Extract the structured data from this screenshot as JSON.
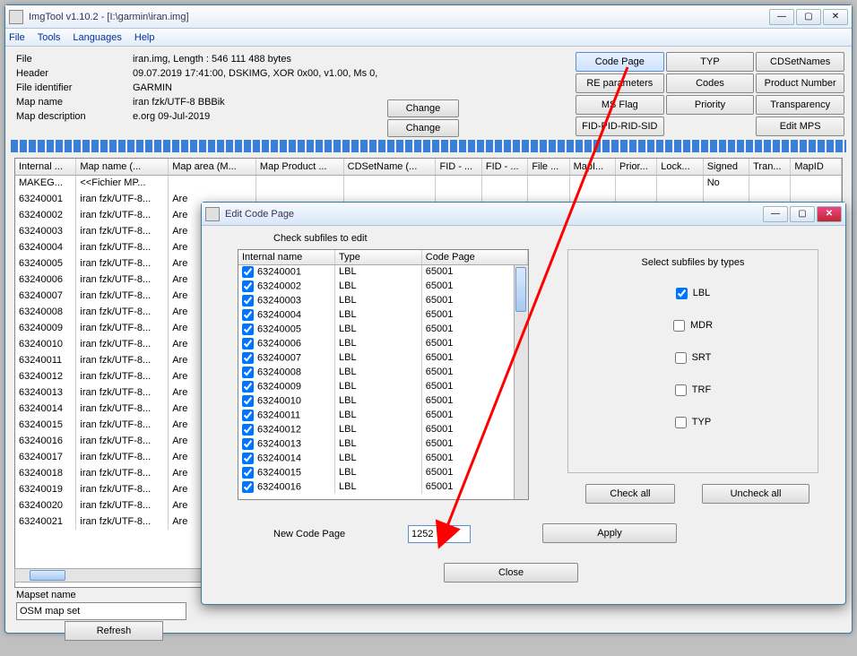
{
  "main": {
    "title": "ImgTool v1.10.2 - [I:\\garmin\\iran.img]",
    "menu": [
      "File",
      "Tools",
      "Languages",
      "Help"
    ],
    "info": {
      "file_lbl": "File",
      "file_val": "iran.img,   Length :   546 111 488 bytes",
      "header_lbl": "Header",
      "header_val": "09.07.2019   17:41:00,  DSKIMG,   XOR 0x00,   v1.00,  Ms 0,",
      "fid_lbl": "File identifier",
      "fid_val": "GARMIN",
      "mapname_lbl": "Map name",
      "mapname_val": "iran fzk/UTF-8 BBBik",
      "mapdesc_lbl": "Map description",
      "mapdesc_val": "e.org 09-Jul-2019"
    },
    "change": "Change",
    "rbtns": [
      [
        "Code Page",
        "TYP",
        "CDSetNames"
      ],
      [
        "RE parameters",
        "Codes",
        "Product Number"
      ],
      [
        "MS Flag",
        "Priority",
        "Transparency"
      ],
      [
        "FID-PID-RID-SID",
        "",
        "Edit MPS"
      ]
    ],
    "cols": [
      "Internal ...",
      "Map name  (...",
      "Map area  (M...",
      "Map Product ...",
      "CDSetName  (...",
      "FID - ...",
      "FID - ...",
      "File ...",
      "MapI...",
      "Prior...",
      "Lock...",
      "Signed",
      "Tran...",
      "MapID"
    ],
    "rows": [
      {
        "id": "MAKEG...",
        "name": "<<Fichier MP...",
        "area": "",
        "signed": "No"
      },
      {
        "id": "63240001",
        "name": "iran fzk/UTF-8...",
        "area": "Are"
      },
      {
        "id": "63240002",
        "name": "iran fzk/UTF-8...",
        "area": "Are"
      },
      {
        "id": "63240003",
        "name": "iran fzk/UTF-8...",
        "area": "Are"
      },
      {
        "id": "63240004",
        "name": "iran fzk/UTF-8...",
        "area": "Are"
      },
      {
        "id": "63240005",
        "name": "iran fzk/UTF-8...",
        "area": "Are"
      },
      {
        "id": "63240006",
        "name": "iran fzk/UTF-8...",
        "area": "Are"
      },
      {
        "id": "63240007",
        "name": "iran fzk/UTF-8...",
        "area": "Are"
      },
      {
        "id": "63240008",
        "name": "iran fzk/UTF-8...",
        "area": "Are"
      },
      {
        "id": "63240009",
        "name": "iran fzk/UTF-8...",
        "area": "Are"
      },
      {
        "id": "63240010",
        "name": "iran fzk/UTF-8...",
        "area": "Are"
      },
      {
        "id": "63240011",
        "name": "iran fzk/UTF-8...",
        "area": "Are"
      },
      {
        "id": "63240012",
        "name": "iran fzk/UTF-8...",
        "area": "Are"
      },
      {
        "id": "63240013",
        "name": "iran fzk/UTF-8...",
        "area": "Are"
      },
      {
        "id": "63240014",
        "name": "iran fzk/UTF-8...",
        "area": "Are"
      },
      {
        "id": "63240015",
        "name": "iran fzk/UTF-8...",
        "area": "Are"
      },
      {
        "id": "63240016",
        "name": "iran fzk/UTF-8...",
        "area": "Are"
      },
      {
        "id": "63240017",
        "name": "iran fzk/UTF-8...",
        "area": "Are"
      },
      {
        "id": "63240018",
        "name": "iran fzk/UTF-8...",
        "area": "Are"
      },
      {
        "id": "63240019",
        "name": "iran fzk/UTF-8...",
        "area": "Are"
      },
      {
        "id": "63240020",
        "name": "iran fzk/UTF-8...",
        "area": "Are"
      },
      {
        "id": "63240021",
        "name": "iran fzk/UTF-8...",
        "area": "Are"
      }
    ],
    "mapset_lbl": "Mapset name",
    "mapset_val": "OSM map set",
    "refresh": "Refresh"
  },
  "dlg": {
    "title": "Edit Code Page",
    "check_lbl": "Check subfiles to edit",
    "cols": [
      "Internal name",
      "Type",
      "Code Page"
    ],
    "rows": [
      {
        "n": "63240001",
        "t": "LBL",
        "c": "65001"
      },
      {
        "n": "63240002",
        "t": "LBL",
        "c": "65001"
      },
      {
        "n": "63240003",
        "t": "LBL",
        "c": "65001"
      },
      {
        "n": "63240004",
        "t": "LBL",
        "c": "65001"
      },
      {
        "n": "63240005",
        "t": "LBL",
        "c": "65001"
      },
      {
        "n": "63240006",
        "t": "LBL",
        "c": "65001"
      },
      {
        "n": "63240007",
        "t": "LBL",
        "c": "65001"
      },
      {
        "n": "63240008",
        "t": "LBL",
        "c": "65001"
      },
      {
        "n": "63240009",
        "t": "LBL",
        "c": "65001"
      },
      {
        "n": "63240010",
        "t": "LBL",
        "c": "65001"
      },
      {
        "n": "63240011",
        "t": "LBL",
        "c": "65001"
      },
      {
        "n": "63240012",
        "t": "LBL",
        "c": "65001"
      },
      {
        "n": "63240013",
        "t": "LBL",
        "c": "65001"
      },
      {
        "n": "63240014",
        "t": "LBL",
        "c": "65001"
      },
      {
        "n": "63240015",
        "t": "LBL",
        "c": "65001"
      },
      {
        "n": "63240016",
        "t": "LBL",
        "c": "65001"
      }
    ],
    "types_lbl": "Select subfiles by types",
    "types": [
      {
        "n": "LBL",
        "c": true
      },
      {
        "n": "MDR",
        "c": false
      },
      {
        "n": "SRT",
        "c": false
      },
      {
        "n": "TRF",
        "c": false
      },
      {
        "n": "TYP",
        "c": false
      }
    ],
    "checkall": "Check all",
    "uncheckall": "Uncheck all",
    "ncp_lbl": "New Code Page",
    "ncp_val": "1252",
    "apply": "Apply",
    "close": "Close"
  }
}
